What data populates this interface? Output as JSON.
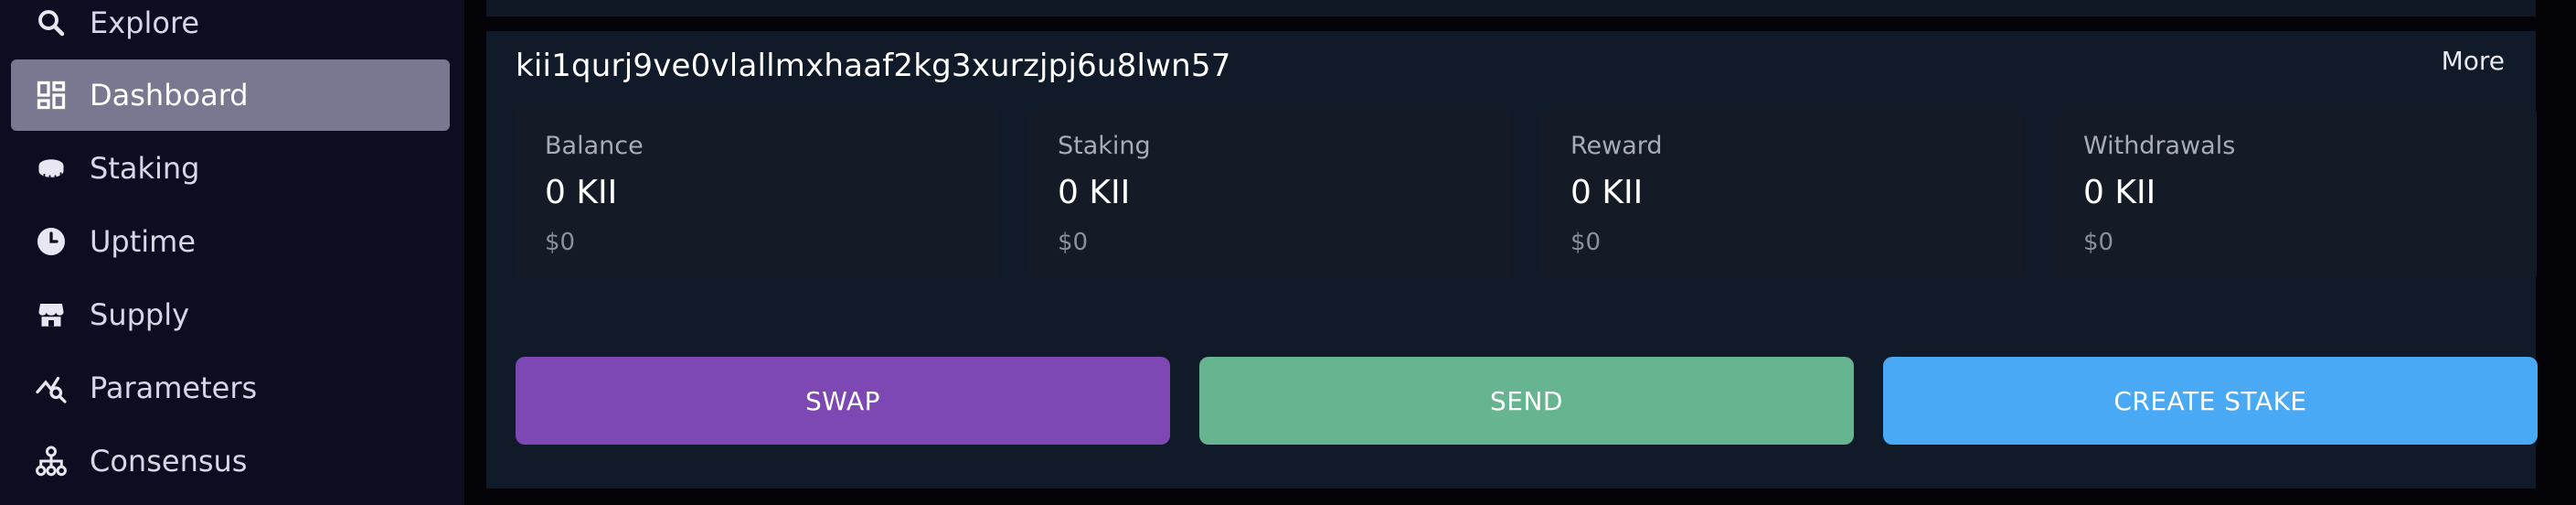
{
  "sidebar": {
    "items": [
      {
        "label": "Explore",
        "icon": "search-icon",
        "active": false
      },
      {
        "label": "Dashboard",
        "icon": "dashboard-icon",
        "active": true
      },
      {
        "label": "Staking",
        "icon": "coin-stack-icon",
        "active": false
      },
      {
        "label": "Uptime",
        "icon": "clock-icon",
        "active": false
      },
      {
        "label": "Supply",
        "icon": "store-icon",
        "active": false
      },
      {
        "label": "Parameters",
        "icon": "chart-search-icon",
        "active": false
      },
      {
        "label": "Consensus",
        "icon": "network-icon",
        "active": false
      }
    ]
  },
  "account": {
    "address": "kii1qurj9ve0vlallmxhaaf2kg3xurzjpj6u8lwn57",
    "more_label": "More",
    "stats": [
      {
        "label": "Balance",
        "value": "0 KII",
        "usd": "$0"
      },
      {
        "label": "Staking",
        "value": "0 KII",
        "usd": "$0"
      },
      {
        "label": "Reward",
        "value": "0 KII",
        "usd": "$0"
      },
      {
        "label": "Withdrawals",
        "value": "0 KII",
        "usd": "$0"
      }
    ]
  },
  "actions": {
    "swap": {
      "label": "SWAP",
      "color": "#7e48b4"
    },
    "send": {
      "label": "SEND",
      "color": "#66b490"
    },
    "stake": {
      "label": "CREATE STAKE",
      "color": "#4aa9f4"
    }
  },
  "colors": {
    "sidebar_bg": "#0e0c20",
    "active_item_bg": "#7a7790",
    "card_bg": "#111a28",
    "stat_bg": "#141b27"
  }
}
